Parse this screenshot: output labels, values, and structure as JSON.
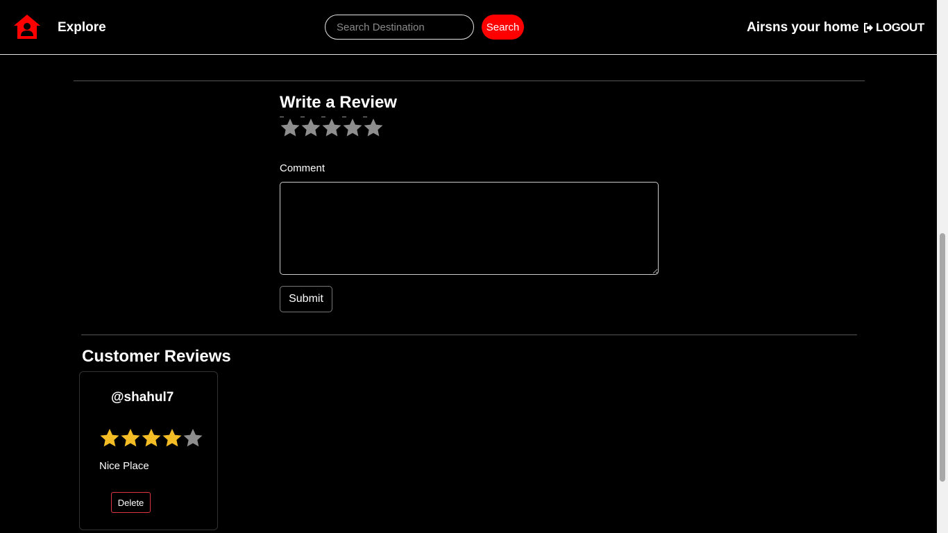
{
  "nav": {
    "explore_label": "Explore",
    "search_placeholder": "Search Destination",
    "search_button": "Search",
    "host_label": "Airsns your home",
    "logout_label": "LOGOUT",
    "brand_color": "#ff0000"
  },
  "review_form": {
    "title": "Write a Review",
    "rating_max": 5,
    "comment_label": "Comment",
    "comment_value": "",
    "submit_label": "Submit"
  },
  "reviews": {
    "title": "Customer Reviews",
    "items": [
      {
        "author": "@shahul7",
        "rating": 4,
        "rating_max": 5,
        "comment": "Nice Place",
        "delete_label": "Delete"
      }
    ]
  },
  "colors": {
    "star_filled": "#f5bd25",
    "star_empty": "#8e8e8e"
  }
}
